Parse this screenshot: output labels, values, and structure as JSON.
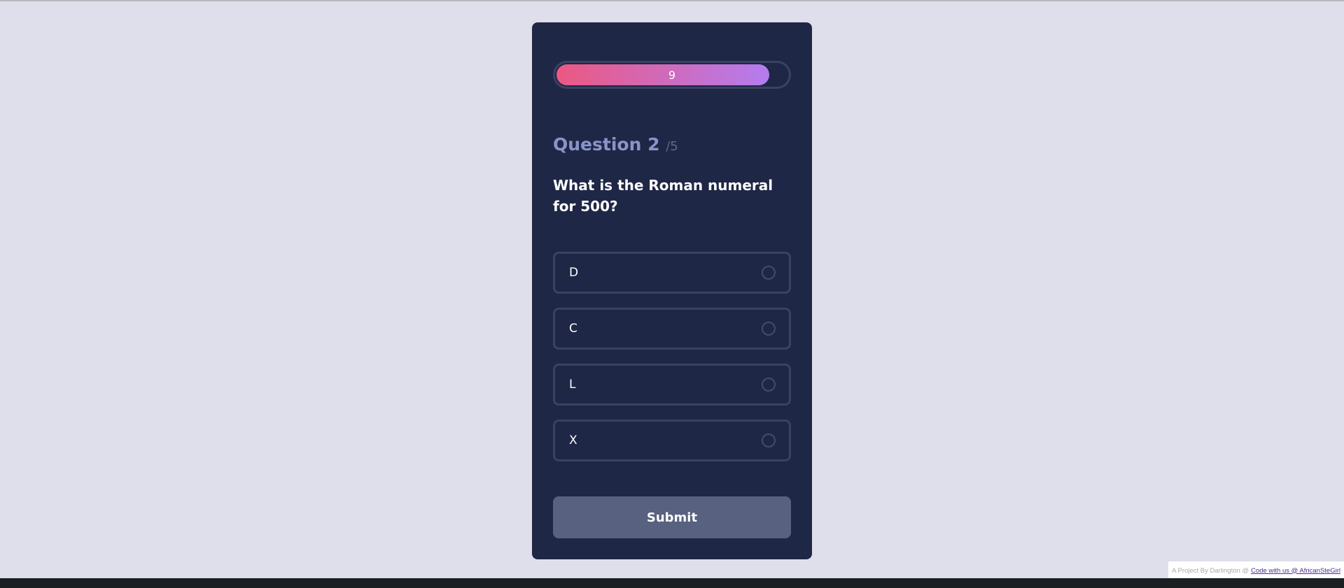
{
  "timer": {
    "value": "9",
    "fill_fraction": 0.92
  },
  "question": {
    "label": "Question 2",
    "total": "/5",
    "text": "What is the Roman numeral for 500?"
  },
  "options": [
    {
      "label": "D"
    },
    {
      "label": "C"
    },
    {
      "label": "L"
    },
    {
      "label": "X"
    }
  ],
  "submit_label": "Submit",
  "credit": {
    "text": "A Project By Darlington @",
    "link_text": "Code with us @ AfricanSteGirl"
  },
  "colors": {
    "background": "#dedfea",
    "card": "#1f2746",
    "timer_gradient_start": "#ec5882",
    "timer_gradient_end": "#b47cf0",
    "submit": "#58617f"
  }
}
